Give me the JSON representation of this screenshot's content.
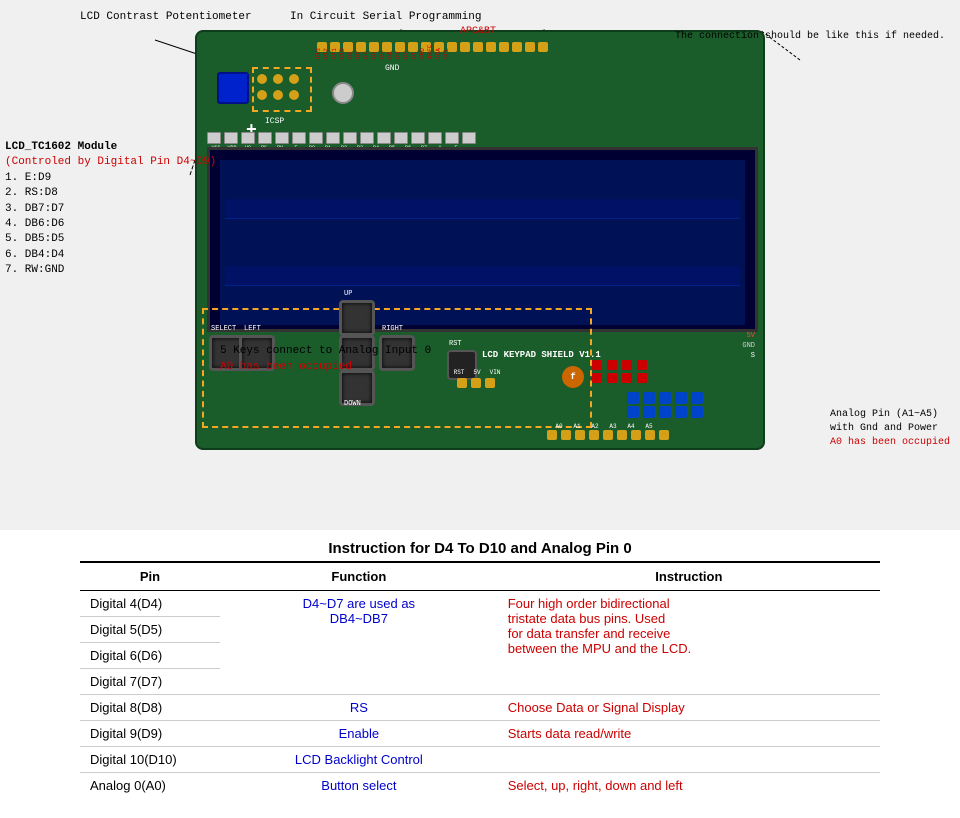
{
  "diagram": {
    "annotations": {
      "lcd_contrast": "LCD  Contrast\nPotentiometer",
      "icsp": "In Circuit Serial\nProgramming",
      "apcbt": "APC&BT",
      "connection_note": "The connection\nshould be like\nthis if needed.",
      "lcd_module_title": "LCD_TC1602 Module",
      "lcd_module_sub": "(Controled by\nDigital Pin D4~D9)",
      "lcd_pins": [
        "1.  E:D9",
        "2.  RS:D8",
        "3.  DB7:D7",
        "4.  DB6:D6",
        "5.  DB5:D5",
        "6.  DB4:D4",
        "7.  RW:GND"
      ],
      "five_keys": "5 Keys connect to\nAnalog Input 0",
      "five_keys_note": "A0 has been occupied",
      "analog_right_title": "Analog Pin (A1~A5)",
      "analog_right_sub": "with Gnd and Power",
      "analog_right_note": "A0 has been occupied",
      "shield_label": "LCD KEYPAD SHIELD V1.1",
      "button_labels": {
        "select": "SELECT",
        "left": "LEFT",
        "up": "UP",
        "right": "RIGHT",
        "rst": "RST",
        "down": "DOWN"
      },
      "power_labels": [
        "5V",
        "GND",
        "S"
      ],
      "analog_pin_labels": [
        "A0",
        "A1",
        "A2",
        "A3",
        "A4",
        "A5"
      ],
      "conn_pin_labels": [
        "VSS",
        "VDD",
        "V0",
        "RS",
        "RW",
        "E",
        "D0",
        "D1",
        "D2",
        "D3",
        "D4",
        "D5",
        "D6",
        "D7",
        "A",
        "E"
      ],
      "top_pin_labels": [
        "D13",
        "D12",
        "D11",
        "D10",
        "D9",
        "D8",
        "D7",
        "D6",
        "D5",
        "D4",
        "D3",
        "D2",
        "D1",
        "D0",
        "GND",
        "AREF",
        "SDA",
        "SCL"
      ],
      "gnd_label": "GND"
    }
  },
  "table": {
    "title": "Instruction for D4 To D10 and Analog Pin 0",
    "headers": [
      "Pin",
      "Function",
      "Instruction"
    ],
    "rows": [
      {
        "pin": "Digital  4(D4)",
        "function": "",
        "instruction": "",
        "func_group": "D4~D7 are used as\nDB4~DB7",
        "instr_group": "Four high order bidirectional\ntristate data bus pins. Used\nfor data transfer and receive\nbetween the MPU and the LCD.",
        "group_span": 4
      },
      {
        "pin": "Digital  5(D5)",
        "function": "",
        "instruction": ""
      },
      {
        "pin": "Digital  6(D6)",
        "function": "",
        "instruction": ""
      },
      {
        "pin": "Digital  7(D7)",
        "function": "",
        "instruction": ""
      },
      {
        "pin": "Digital  8(D8)",
        "function": "RS",
        "instruction": "Choose Data or Signal Display"
      },
      {
        "pin": "Digital  9(D9)",
        "function": "Enable",
        "instruction": "Starts data read/write"
      },
      {
        "pin": "Digital 10(D10)",
        "function": "LCD Backlight Control",
        "instruction": ""
      },
      {
        "pin": "Analog  0(A0)",
        "function": "Button select",
        "instruction": "Select, up, right, down and left"
      }
    ]
  }
}
